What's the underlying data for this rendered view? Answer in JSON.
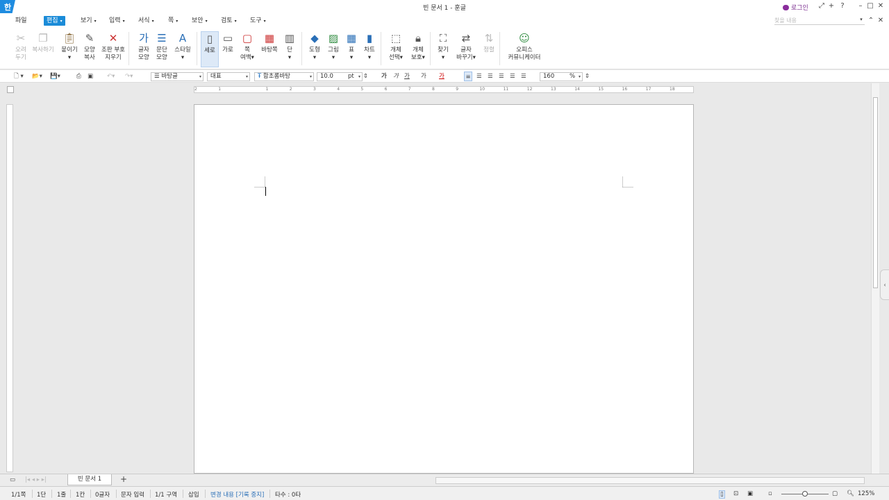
{
  "window": {
    "title": "빈 문서 1 - 훈글",
    "logo": "한",
    "login": "로그인"
  },
  "menus": [
    {
      "label": "파일",
      "active": false,
      "caret": false
    },
    {
      "label": "편집",
      "active": true,
      "caret": true
    },
    {
      "label": "보기",
      "active": false,
      "caret": true
    },
    {
      "label": "입력",
      "active": false,
      "caret": true
    },
    {
      "label": "서식",
      "active": false,
      "caret": true
    },
    {
      "label": "쪽",
      "active": false,
      "caret": true
    },
    {
      "label": "보안",
      "active": false,
      "caret": true
    },
    {
      "label": "검토",
      "active": false,
      "caret": true
    },
    {
      "label": "도구",
      "active": false,
      "caret": true
    }
  ],
  "search_placeholder": "찾을 내용",
  "ribbon": [
    {
      "name": "cut",
      "l1": "오려",
      "l2": "두기",
      "dis": true,
      "icon": "scissors-icon"
    },
    {
      "name": "copy",
      "l1": "복사하기",
      "l2": "",
      "dis": true,
      "icon": "copy-icon"
    },
    {
      "name": "paste",
      "l1": "붙이기",
      "l2": "▾",
      "icon": "paste-icon"
    },
    {
      "name": "format-copy",
      "l1": "모양",
      "l2": "복사",
      "icon": "format-painter-icon"
    },
    {
      "name": "clear-markup",
      "l1": "조판 부호",
      "l2": "지우기",
      "icon": "clear-markup-icon"
    },
    {
      "name": "char-shape",
      "l1": "글자",
      "l2": "모양",
      "icon": "char-shape-icon"
    },
    {
      "name": "para-shape",
      "l1": "문단",
      "l2": "모양",
      "icon": "para-shape-icon"
    },
    {
      "name": "style",
      "l1": "스타일",
      "l2": "▾",
      "icon": "style-icon"
    },
    {
      "name": "portrait",
      "l1": "세로",
      "l2": "",
      "sel": true,
      "icon": "portrait-icon"
    },
    {
      "name": "landscape",
      "l1": "가로",
      "l2": "",
      "icon": "landscape-icon"
    },
    {
      "name": "margin",
      "l1": "쪽",
      "l2": "여백▾",
      "icon": "margin-icon"
    },
    {
      "name": "background",
      "l1": "바탕쪽",
      "l2": "",
      "icon": "background-page-icon"
    },
    {
      "name": "columns",
      "l1": "단",
      "l2": "▾",
      "icon": "columns-icon"
    },
    {
      "name": "shape",
      "l1": "도형",
      "l2": "▾",
      "icon": "shape-icon"
    },
    {
      "name": "picture",
      "l1": "그림",
      "l2": "▾",
      "icon": "picture-icon"
    },
    {
      "name": "table",
      "l1": "표",
      "l2": "▾",
      "icon": "table-icon"
    },
    {
      "name": "chart",
      "l1": "차트",
      "l2": "▾",
      "icon": "chart-icon"
    },
    {
      "name": "obj-select",
      "l1": "개체",
      "l2": "선택▾",
      "icon": "object-select-icon"
    },
    {
      "name": "obj-protect",
      "l1": "개체",
      "l2": "보호▾",
      "icon": "object-protect-icon"
    },
    {
      "name": "find",
      "l1": "찾기",
      "l2": "▾",
      "icon": "binoculars-icon"
    },
    {
      "name": "replace",
      "l1": "글자",
      "l2": "바꾸기▾",
      "icon": "replace-icon"
    },
    {
      "name": "sort",
      "l1": "정렬",
      "l2": "",
      "dis": true,
      "icon": "sort-icon"
    },
    {
      "name": "office-comm",
      "l1": "오피스",
      "l2": "커뮤니케이터",
      "icon": "communicator-icon"
    }
  ],
  "toolbar": {
    "style": "바탕글",
    "lang": "대표",
    "font": "함초롬바탕",
    "size": "10.0",
    "unit": "pt",
    "zoom": "160",
    "zoom_unit": "%",
    "b": "가",
    "i": "가",
    "u": "가",
    "s": "가",
    "c": "가"
  },
  "ruler_nums": [
    "2",
    "1",
    "",
    "1",
    "2",
    "3",
    "4",
    "5",
    "6",
    "7",
    "8",
    "9",
    "10",
    "11",
    "12",
    "13",
    "14",
    "15",
    "16",
    "17",
    "18"
  ],
  "doc_tab": "빈 문서 1",
  "status": {
    "page": "1/1쪽",
    "col": "1단",
    "line": "1줄",
    "chr": "1칸",
    "count": "0글자",
    "mode": "문자 입력",
    "section": "1/1 구역",
    "insert": "삽입",
    "track": "변경 내용 [기록 중지]",
    "typing": "타수 : 0타",
    "zoom": "125%"
  }
}
